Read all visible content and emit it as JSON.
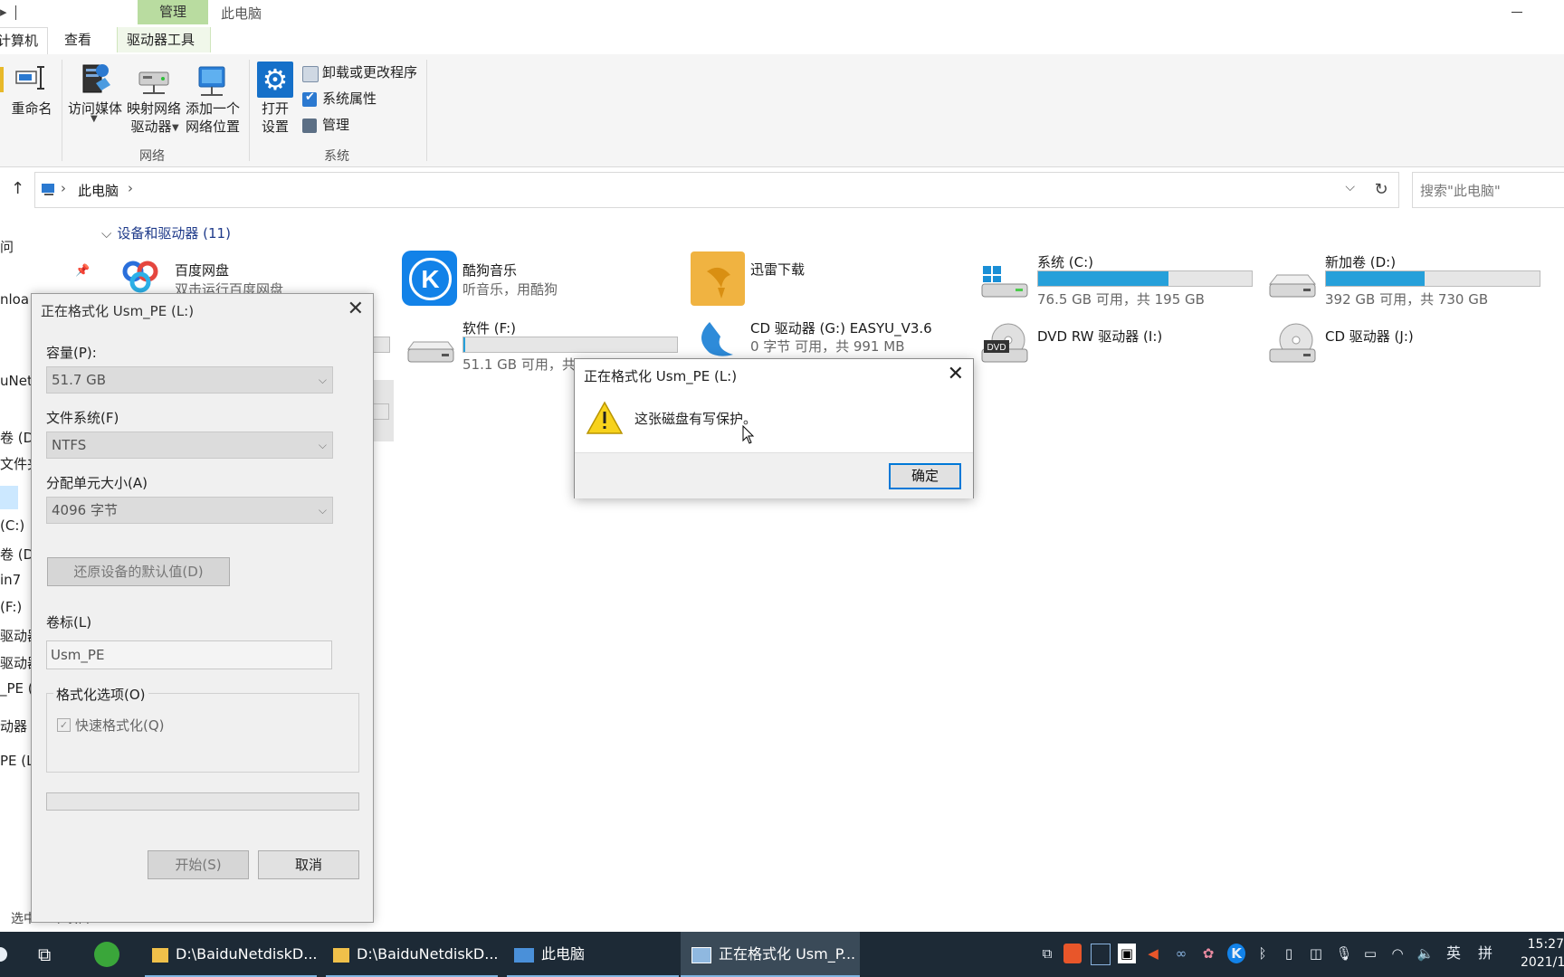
{
  "window": {
    "title": "此电脑",
    "context_tab": "管理"
  },
  "ribbon": {
    "tabs": [
      "计算机",
      "查看",
      "驱动器工具"
    ],
    "network_group": {
      "name": "网络",
      "rename": "重命名",
      "media": "访问媒体",
      "map_drive_1": "映射网络",
      "map_drive_2": "驱动器",
      "add_location_1": "添加一个",
      "add_location_2": "网络位置"
    },
    "system_group": {
      "name": "系统",
      "open_1": "打开",
      "open_2": "设置",
      "uninstall": "卸载或更改程序",
      "properties": "系统属性",
      "manage": "管理"
    }
  },
  "address": {
    "crumb": "此电脑",
    "search_placeholder": "搜索\"此电脑\""
  },
  "nav": {
    "items": [
      "问",
      "nloa",
      "uNet",
      "卷 (D",
      "文件夹",
      "(C:)",
      "卷 (D",
      "in7",
      "(F:)",
      "驱动器",
      "驱动器",
      "_PE (",
      "动器",
      "PE (L:"
    ]
  },
  "section": {
    "title": "设备和驱动器 (11)"
  },
  "items": {
    "baidu": {
      "name": "百度网盘",
      "sub": "双击运行百度网盘"
    },
    "kugou": {
      "name": "酷狗音乐",
      "sub": "听音乐，用酷狗"
    },
    "xunlei": {
      "name": "迅雷下载"
    },
    "c": {
      "name": "系统 (C:)",
      "sub": "76.5 GB 可用，共 195 GB",
      "used_fraction": 0.61
    },
    "d": {
      "name": "新加卷 (D:)",
      "sub": "392 GB 可用，共 730 GB",
      "used_fraction": 0.46
    },
    "f": {
      "name": "软件 (F:)",
      "sub": "51.1 GB 可用，共",
      "used_fraction": 0.01
    },
    "g": {
      "name": "CD 驱动器 (G:) EASYU_V3.6",
      "sub": "0 字节 可用，共 991 MB"
    },
    "i": {
      "name": "DVD RW 驱动器 (I:)",
      "dvd_badge": "DVD"
    },
    "j": {
      "name": "CD 驱动器 (J:)"
    }
  },
  "format_dialog": {
    "title": "正在格式化 Usm_PE (L:)",
    "capacity_label": "容量(P):",
    "capacity_value": "51.7 GB",
    "fs_label": "文件系统(F)",
    "fs_value": "NTFS",
    "alloc_label": "分配单元大小(A)",
    "alloc_value": "4096 字节",
    "restore_button": "还原设备的默认值(D)",
    "volume_label": "卷标(L)",
    "volume_value": "Usm_PE",
    "options_label": "格式化选项(O)",
    "quick_format": "快速格式化(Q)",
    "start_button": "开始(S)",
    "cancel_button": "取消"
  },
  "message_box": {
    "title": "正在格式化 Usm_PE (L:)",
    "text": "这张磁盘有写保护。",
    "ok": "确定"
  },
  "status_bar": {
    "text": "选中 1 个项目"
  },
  "taskbar": {
    "items": [
      "D:\\BaiduNetdiskD...",
      "D:\\BaiduNetdiskD...",
      "此电脑",
      "正在格式化 Usm_P..."
    ],
    "ime": "英",
    "ime2": "拼",
    "time": "15:27",
    "date": "2021/1"
  },
  "colors": {
    "accent": "#0078d7",
    "drive_bar": "#26a0da",
    "context_tab": "#b9dca0",
    "taskbar": "#1d2a36"
  }
}
